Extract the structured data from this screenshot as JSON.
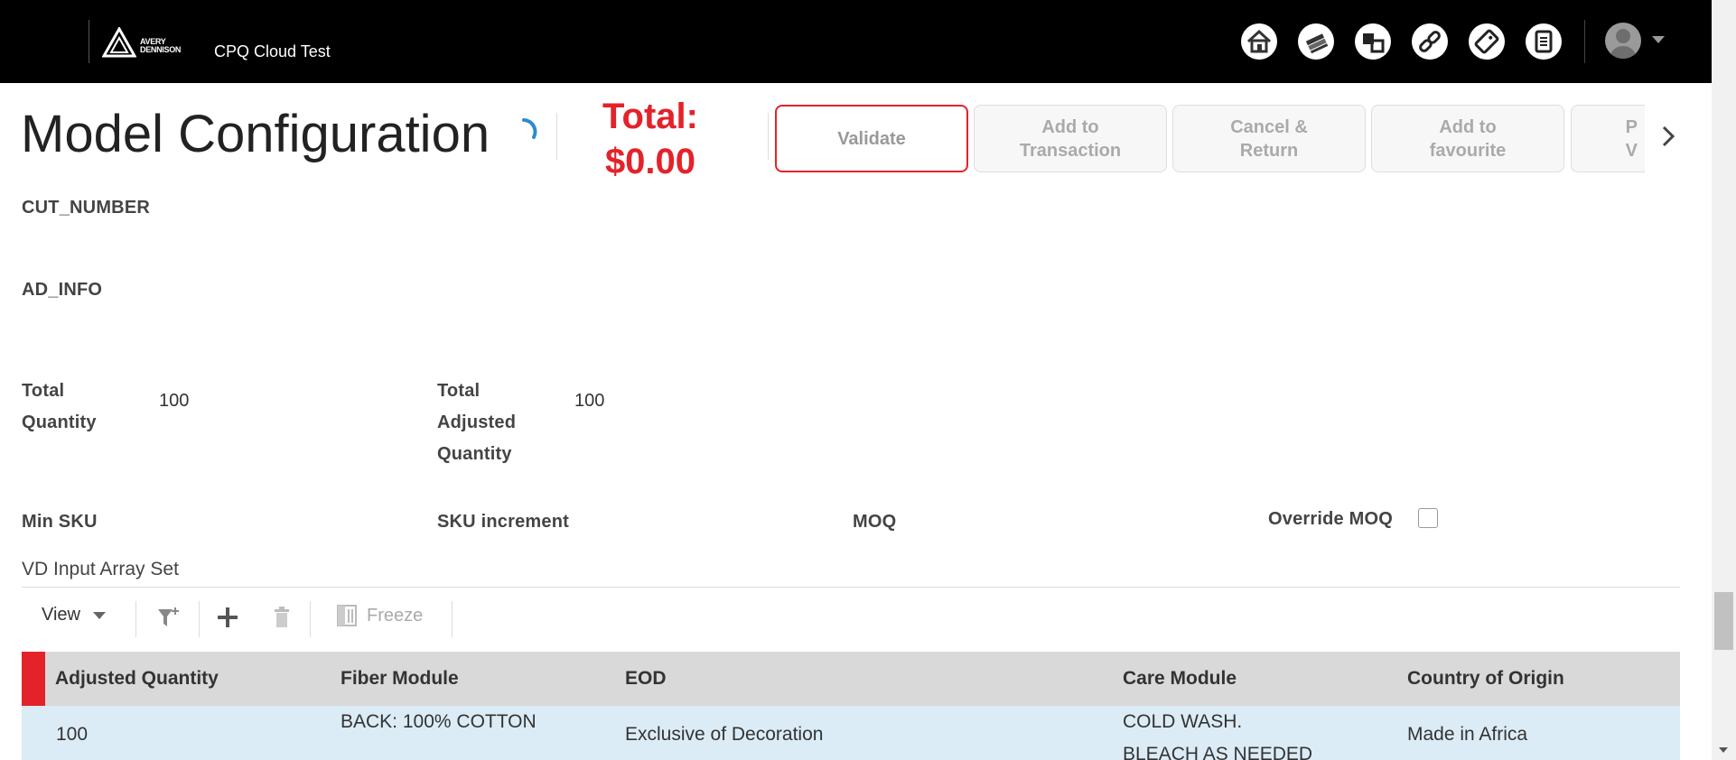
{
  "header": {
    "logo_brand_line1": "AVERY",
    "logo_brand_line2": "DENNISON",
    "app_title": "CPQ Cloud Test",
    "nav_icons": [
      "home-icon",
      "transactions-icon",
      "products-icon",
      "links-icon",
      "tag-icon",
      "documents-icon"
    ],
    "user_menu_icon": "avatar-icon"
  },
  "page": {
    "title": "Model Configuration",
    "total_label": "Total:",
    "total_value": "$0.00"
  },
  "actions": [
    {
      "label_line1": "Validate",
      "label_line2": ""
    },
    {
      "label_line1": "Add to",
      "label_line2": "Transaction"
    },
    {
      "label_line1": "Cancel &",
      "label_line2": "Return"
    },
    {
      "label_line1": "Add to",
      "label_line2": "favourite"
    },
    {
      "label_line1": "P",
      "label_line2": "V"
    }
  ],
  "fields": {
    "cut_number_label": "CUT_NUMBER",
    "ad_info_label": "AD_INFO",
    "total_quantity_label": [
      "Total",
      "Quantity"
    ],
    "total_quantity_value": "100",
    "total_adjusted_quantity_label": [
      "Total",
      "Adjusted",
      "Quantity"
    ],
    "total_adjusted_quantity_value": "100",
    "min_sku_label": "Min SKU",
    "sku_increment_label": "SKU increment",
    "moq_label": "MOQ",
    "override_moq_label": "Override MOQ",
    "override_moq_checked": false
  },
  "array_set": {
    "title": "VD Input Array Set",
    "toolbar": {
      "view_label": "View",
      "freeze_label": "Freeze",
      "icons": [
        "filter-icon",
        "add-icon",
        "delete-icon",
        "freeze-icon"
      ]
    },
    "columns": [
      "Adjusted Quantity",
      "Fiber Module",
      "EOD",
      "Care Module",
      "Country of Origin"
    ],
    "rows": [
      {
        "adjusted_quantity": "100",
        "fiber_module": "BACK:  100% COTTON",
        "eod": "Exclusive of Decoration",
        "care_module_line1": "COLD WASH.",
        "care_module_line2": "BLEACH AS NEEDED",
        "country_of_origin": "Made in Africa"
      }
    ]
  },
  "colors": {
    "accent_red": "#e4222a",
    "topbar": "#000000",
    "table_header": "#d9d9d9",
    "row_highlight": "#dcecf6"
  }
}
